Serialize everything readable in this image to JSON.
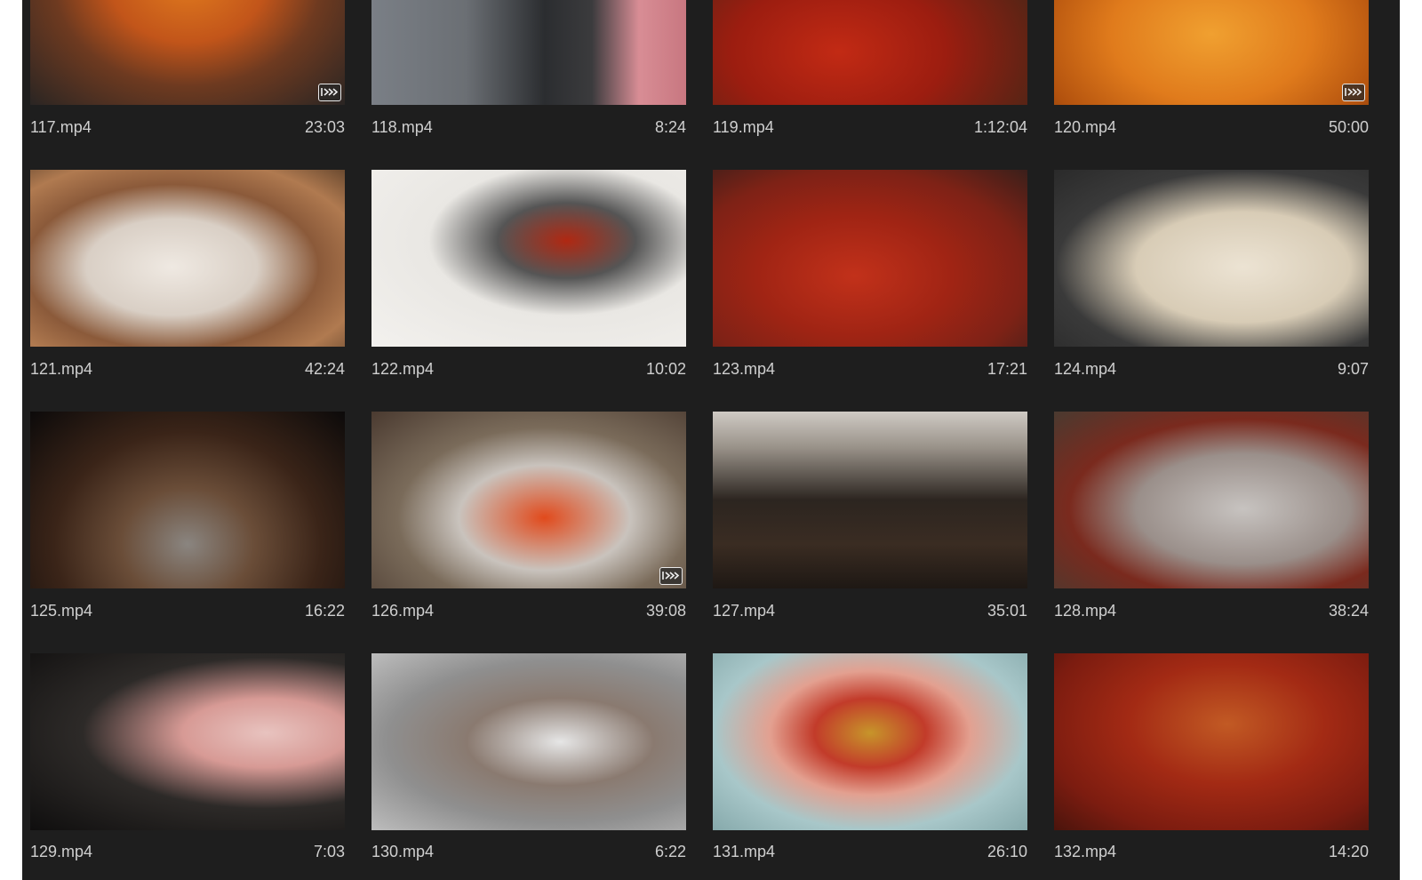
{
  "clips": [
    {
      "name": "117.mp4",
      "duration": "23:03"
    },
    {
      "name": "118.mp4",
      "duration": "8:24"
    },
    {
      "name": "119.mp4",
      "duration": "1:12:04"
    },
    {
      "name": "120.mp4",
      "duration": "50:00"
    },
    {
      "name": "121.mp4",
      "duration": "42:24"
    },
    {
      "name": "122.mp4",
      "duration": "10:02"
    },
    {
      "name": "123.mp4",
      "duration": "17:21"
    },
    {
      "name": "124.mp4",
      "duration": "9:07"
    },
    {
      "name": "125.mp4",
      "duration": "16:22"
    },
    {
      "name": "126.mp4",
      "duration": "39:08"
    },
    {
      "name": "127.mp4",
      "duration": "35:01"
    },
    {
      "name": "128.mp4",
      "duration": "38:24"
    },
    {
      "name": "129.mp4",
      "duration": "7:03"
    },
    {
      "name": "130.mp4",
      "duration": "6:22"
    },
    {
      "name": "131.mp4",
      "duration": "26:10"
    },
    {
      "name": "132.mp4",
      "duration": "14:20"
    }
  ],
  "colors": {
    "panel_background": "#1e1e1e",
    "label_text": "#cfcfcf"
  }
}
